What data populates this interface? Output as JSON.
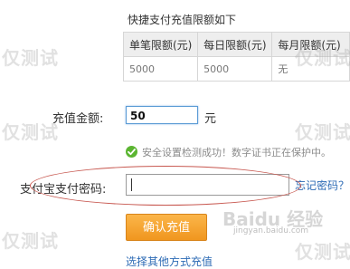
{
  "limits": {
    "title": "快捷支付充值限额如下",
    "headers": [
      "单笔限额(元)",
      "每日限额(元)",
      "每月限额(元)"
    ],
    "row": [
      "5000",
      "5000",
      "无"
    ]
  },
  "amount": {
    "label": "充值金额:",
    "value": "50",
    "unit": "元"
  },
  "security": {
    "icon": "check-circle-icon",
    "message": "安全设置检测成功！数字证书正在保护中。"
  },
  "password": {
    "label": "支付宝支付密码:",
    "value": "",
    "forgot_link": "忘记密码？"
  },
  "confirm_button": "确认充值",
  "other_methods_link": "选择其他方式充值",
  "watermarks": {
    "text": "仅测试",
    "baidu": "Baidu 经验",
    "baidu_url": "jingyan.baidu.com"
  },
  "colors": {
    "button": "#f0961f",
    "link": "#2d6bb5",
    "highlight_oval": "#c7574f",
    "check": "#5bb531"
  }
}
